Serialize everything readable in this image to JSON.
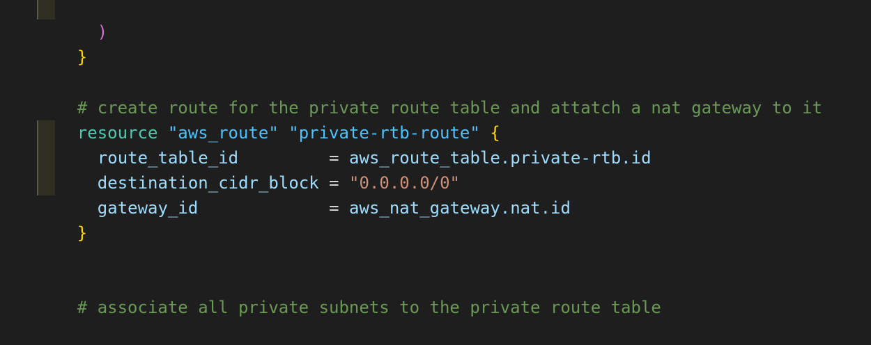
{
  "editor": {
    "lines": {
      "paren_close": ")",
      "brace_close_1": "}",
      "comment_1": "# create route for the private route table and attatch a nat gateway to it",
      "resource_keyword": "resource",
      "resource_type": "\"aws_route\"",
      "resource_name": "\"private-rtb-route\"",
      "brace_open": "{",
      "attr_1_name": "route_table_id",
      "attr_1_op": "=",
      "attr_1_value": "aws_route_table.private-rtb.id",
      "attr_2_name": "destination_cidr_block",
      "attr_2_op": "=",
      "attr_2_value": "\"0.0.0.0/0\"",
      "attr_3_name": "gateway_id",
      "attr_3_op": "=",
      "attr_3_value": "aws_nat_gateway.nat.id",
      "brace_close_2": "}",
      "comment_2": "# associate all private subnets to the private route table"
    }
  },
  "colors": {
    "background": "#1e1e1e",
    "comment": "#6a9955",
    "keyword": "#4ec9b0",
    "string_label": "#4fc1ff",
    "attribute": "#9cdcfe",
    "string_value": "#ce9178",
    "brace": "#ffd700",
    "paren": "#da70d6"
  }
}
